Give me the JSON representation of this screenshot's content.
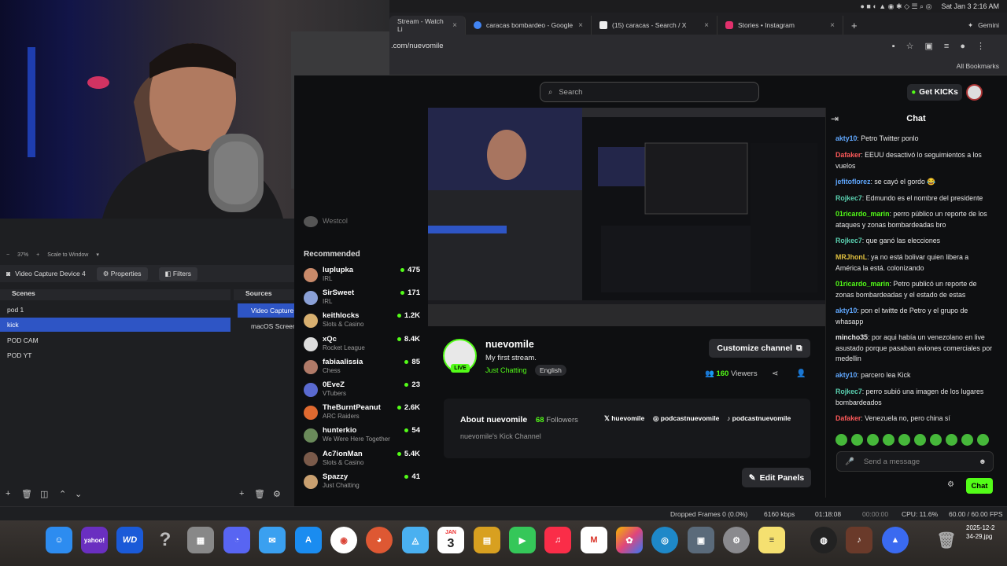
{
  "menubar": {
    "datetime": "Sat Jan 3  2:16 AM",
    "gemini": "Gemini"
  },
  "browser": {
    "tabs": [
      {
        "label": "Stream - Watch Li",
        "icon": "kick-favicon",
        "color": "#53fc18"
      },
      {
        "label": "caracas bombardeo - Google",
        "icon": "google-favicon",
        "color": "#4285f4"
      },
      {
        "label": "(15) caracas - Search / X",
        "icon": "x-favicon",
        "color": "#ffffff"
      },
      {
        "label": "Stories • Instagram",
        "icon": "instagram-favicon",
        "color": "#e1306c"
      }
    ],
    "url": ".com/nuevomile",
    "all_bookmarks": "All Bookmarks"
  },
  "kick": {
    "search_placeholder": "Search",
    "get_kicks": "Get KICKs",
    "sidebar": {
      "partial_name": "Westcol",
      "recommended_title": "Recommended",
      "channels": [
        {
          "name": "luplupka",
          "game": "IRL",
          "viewers": "475",
          "color": "#c98a6a"
        },
        {
          "name": "SirSweet",
          "game": "IRL",
          "viewers": "171",
          "color": "#8aa0d6"
        },
        {
          "name": "keithlocks",
          "game": "Slots & Casino",
          "viewers": "1.2K",
          "color": "#d8b070"
        },
        {
          "name": "xQc",
          "game": "Rocket League",
          "viewers": "8.4K",
          "color": "#dddddd"
        },
        {
          "name": "fabiaalissia",
          "game": "Chess",
          "viewers": "85",
          "color": "#b07a68"
        },
        {
          "name": "0EveZ",
          "game": "VTubers",
          "viewers": "23",
          "color": "#5a6ad0"
        },
        {
          "name": "TheBurntPeanut",
          "game": "ARC Raiders",
          "viewers": "2.6K",
          "color": "#e06a30"
        },
        {
          "name": "hunterkio",
          "game": "We Were Here Together",
          "viewers": "54",
          "color": "#6a8a5a"
        },
        {
          "name": "Ac7ionMan",
          "game": "Slots & Casino",
          "viewers": "5.4K",
          "color": "#7a5a4a"
        },
        {
          "name": "Spazzy",
          "game": "Just Chatting",
          "viewers": "41",
          "color": "#c9a070"
        }
      ]
    },
    "stream": {
      "live_badge": "LIVE",
      "name": "nuevomile",
      "title": "My first stream.",
      "category": "Just Chatting",
      "language": "English",
      "customize": "Customize channel",
      "viewers_count": "160",
      "viewers_label": "Viewers"
    },
    "about": {
      "title": "About nuevomile",
      "followers": "68",
      "followers_label": "Followers",
      "description": "nuevomile's Kick Channel",
      "socials": [
        "huevomile",
        "podcastnuevomile",
        "podcastnuevomile"
      ]
    },
    "edit_panels": "Edit Panels",
    "chat": {
      "title": "Chat",
      "messages": [
        {
          "user": "akty10",
          "text": "Petro Twitter ponlo",
          "color": "#60a8ff"
        },
        {
          "user": "Dafaker",
          "text": "EEUU desactivó lo seguimientos a los vuelos",
          "color": "#ff5a5a"
        },
        {
          "user": "jefitoflorez",
          "text": "se cayó el gordo 😂",
          "color": "#60a8ff"
        },
        {
          "user": "Rojkec7",
          "text": "Edmundo es el nombre del presidente",
          "color": "#5ad0b0"
        },
        {
          "user": "01ricardo_marin",
          "text": "perro público un reporte de los ataques y zonas bombardeadas bro",
          "color": "#53fc18"
        },
        {
          "user": "Rojkec7",
          "text": "que ganó las elecciones",
          "color": "#5ad0b0"
        },
        {
          "user": "MRJhonL",
          "text": "ya no está bolivar quien libera a América la está. colonizando",
          "color": "#e0c040"
        },
        {
          "user": "01ricardo_marin",
          "text": "Petro publicó un reporte de zonas bombardeadas y el estado de estas",
          "color": "#53fc18"
        },
        {
          "user": "akty10",
          "text": "pon el twitte de Petro y el grupo de whasapp",
          "color": "#60a8ff"
        },
        {
          "user": "mincho35",
          "text": "por aqui había un venezolano en live asustado porque pasaban aviones comerciales por medellin",
          "color": "#e8e8e8"
        },
        {
          "user": "akty10",
          "text": "parcero lea Kick",
          "color": "#60a8ff"
        },
        {
          "user": "Rojkec7",
          "text": "perro subió una imagen de los lugares bombardeados",
          "color": "#5ad0b0"
        },
        {
          "user": "Dafaker",
          "text": "Venezuela no, pero china sí",
          "color": "#ff5a5a"
        }
      ],
      "input_placeholder": "Send a message",
      "send_label": "Chat"
    }
  },
  "obs": {
    "zoom": "37%",
    "scale": "Scale to Window",
    "source_name": "Video Capture Device 4",
    "properties": "Properties",
    "filters": "Filters",
    "scenes_title": "Scenes",
    "sources_title": "Sources",
    "scenes": [
      "pod 1",
      "kick",
      "POD CAM",
      "POD YT"
    ],
    "selected_scene": 1,
    "sources": [
      "Video Capture",
      "macOS Screen"
    ],
    "status": {
      "dropped": "Dropped Frames 0 (0.0%)",
      "kbps": "6160 kbps",
      "stream_time": "01:18:08",
      "rec_time": "00:00:00",
      "cpu": "CPU: 11.6%",
      "fps": "60.00 / 60.00 FPS"
    }
  },
  "dock": {
    "calendar_month": "JAN",
    "calendar_day": "3",
    "yahoo": "yahoo!",
    "wd": "WD",
    "file_label_1": "2025-12-2",
    "file_label_2": "34-29.jpg"
  }
}
